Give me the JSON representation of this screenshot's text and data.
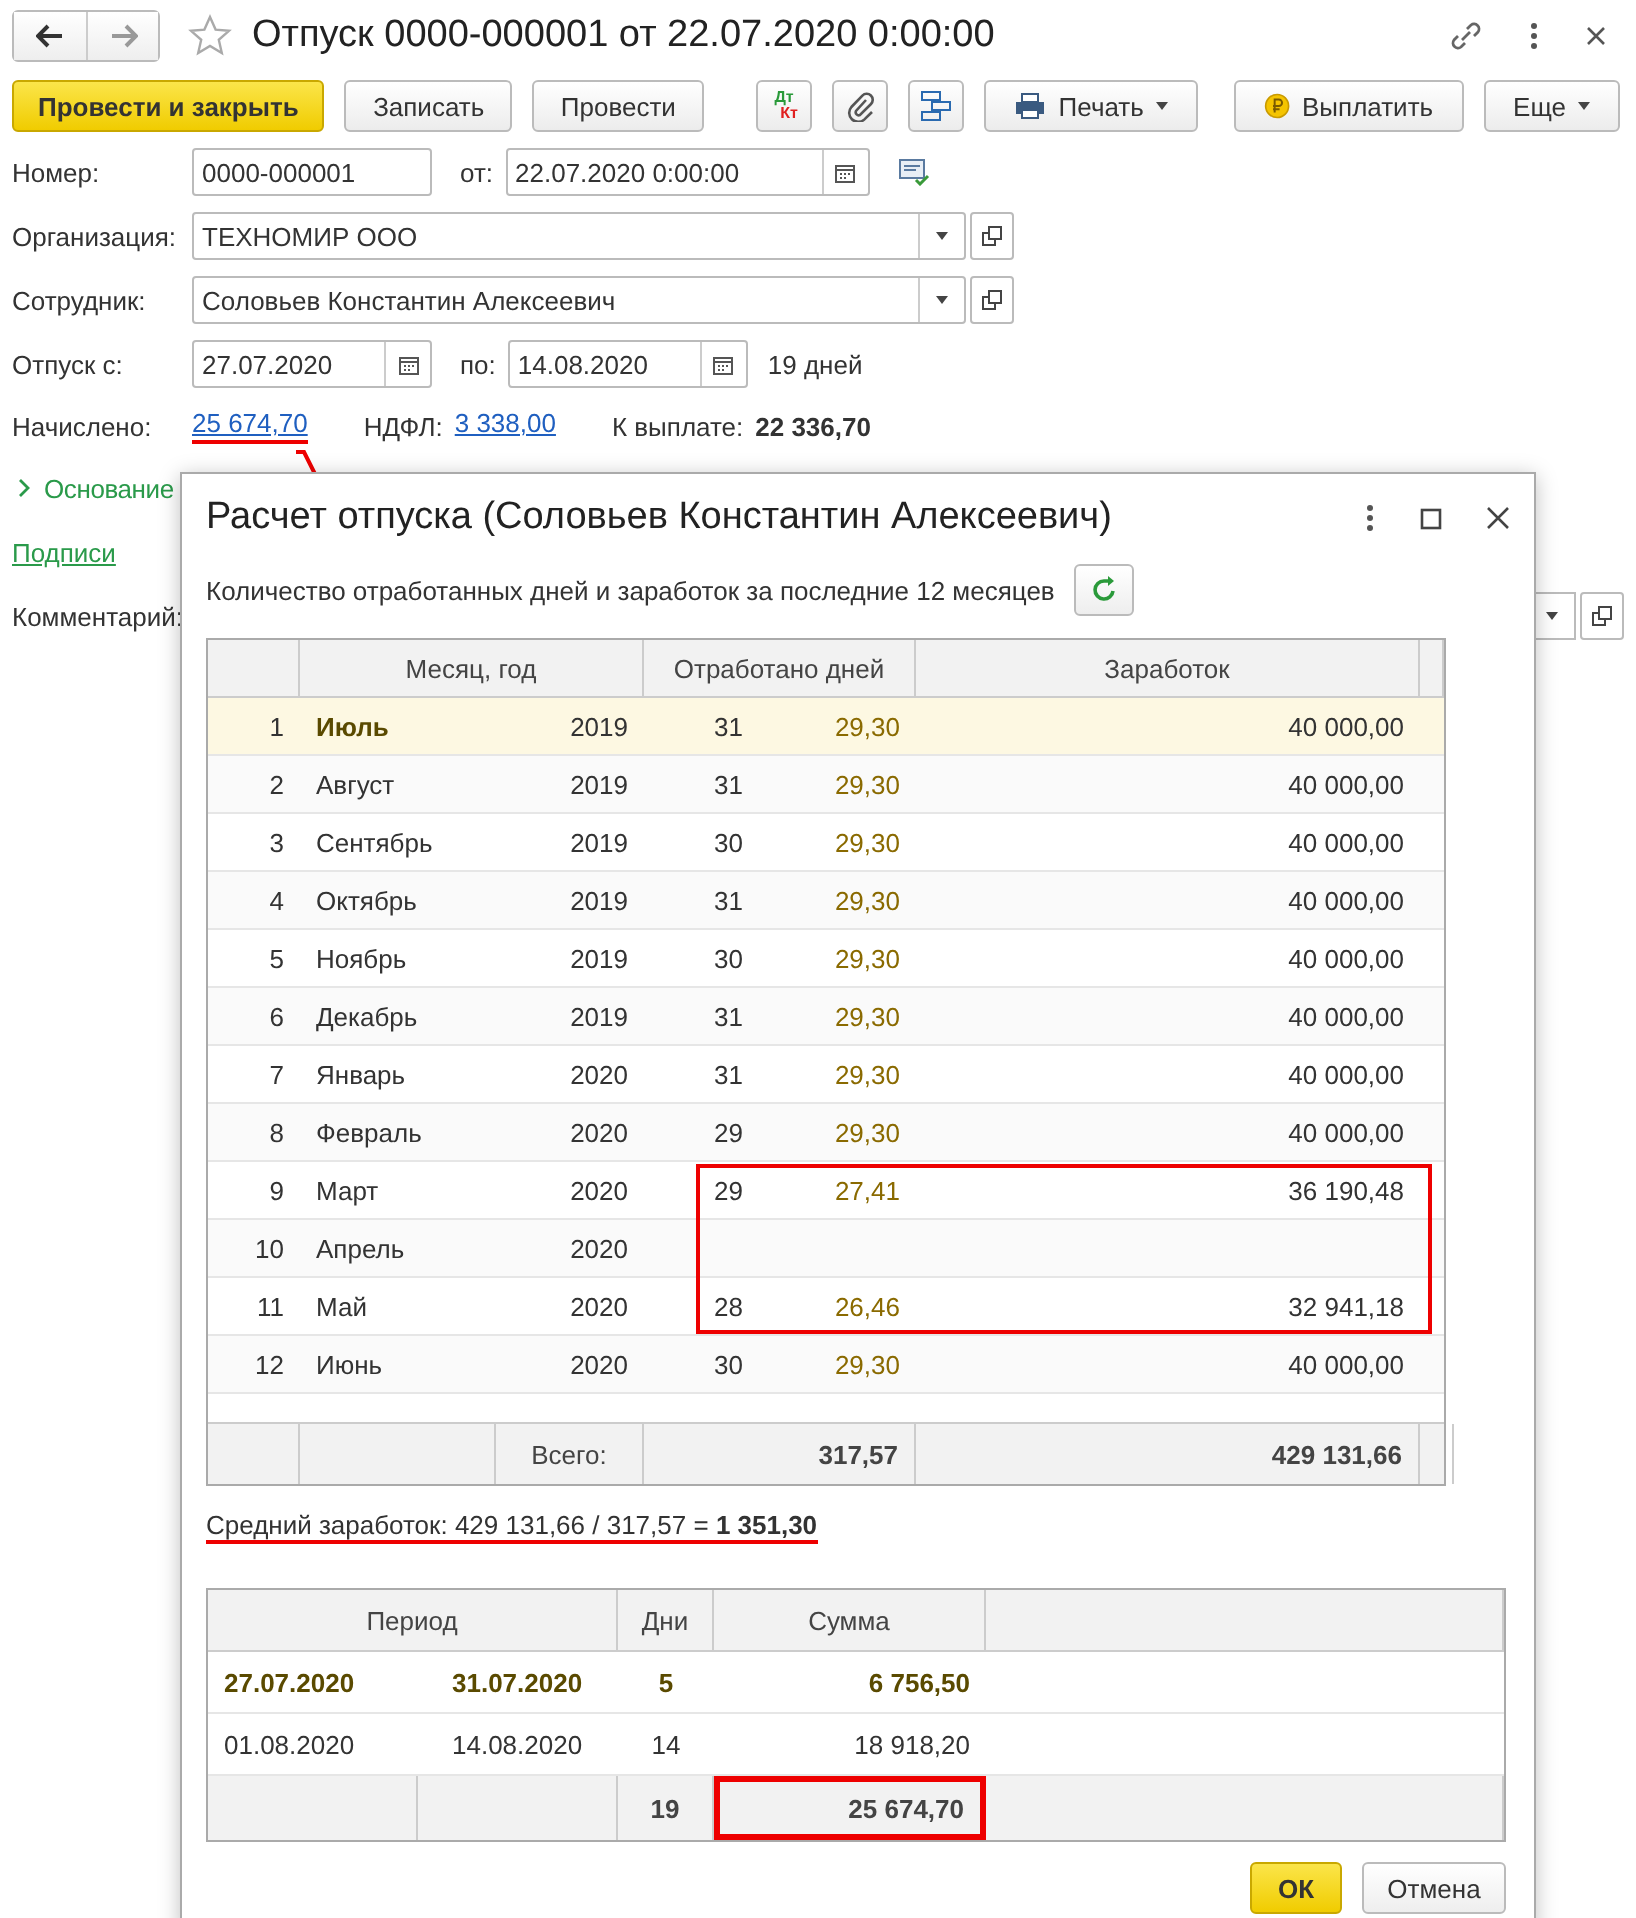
{
  "window": {
    "title": "Отпуск 0000-000001 от 22.07.2020 0:00:00"
  },
  "toolbar": [
    {
      "kind": "primary",
      "label": "Провести и закрыть"
    },
    {
      "kind": "text",
      "label": "Записать"
    },
    {
      "kind": "text",
      "label": "Провести"
    },
    {
      "kind": "dtkt",
      "label": "Дт",
      "label2": "Кт"
    },
    {
      "kind": "clip"
    },
    {
      "kind": "structure"
    },
    {
      "kind": "print",
      "label": "Печать"
    },
    {
      "kind": "pay",
      "label": "Выплатить"
    },
    {
      "kind": "more",
      "label": "Еще"
    }
  ],
  "number": {
    "label": "Номер:",
    "value": "0000-000001",
    "date_label": "от:",
    "date": "22.07.2020  0:00:00"
  },
  "organization": {
    "label": "Организация:",
    "value": "ТЕХНОМИР ООО"
  },
  "employee": {
    "label": "Сотрудник:",
    "value": "Соловьев Константин Алексеевич"
  },
  "vacation": {
    "label": "Отпуск с:",
    "from": "27.07.2020",
    "to_label": "по:",
    "to": "14.08.2020",
    "duration": "19 дней"
  },
  "totals": [
    {
      "kind": "link",
      "label": "Начислено:",
      "value": "25 674,70",
      "marked": true
    },
    {
      "kind": "link",
      "label": "НДФЛ:",
      "value": "3 338,00"
    },
    {
      "kind": "bold",
      "label": "К выплате:",
      "value": "22 336,70"
    }
  ],
  "basis": {
    "label": "Основание",
    "expanded": false
  },
  "signatures": "Подписи",
  "comment": {
    "label": "Комментарий:"
  },
  "dialog": {
    "title": "Расчет отпуска (Соловьев Константин Алексеевич)",
    "subtitle": "Количество отработанных дней и заработок за последние 12 месяцев",
    "earnings_columns": [
      "Месяц, год",
      "Отработано дней",
      "Заработок"
    ],
    "earnings_rows": [
      {
        "n": "1",
        "month": "Июль",
        "year": "2019",
        "days": "31",
        "coef": "29,30",
        "earnings": "40 000,00",
        "selected": true,
        "marked": false
      },
      {
        "n": "2",
        "month": "Август",
        "year": "2019",
        "days": "31",
        "coef": "29,30",
        "earnings": "40 000,00",
        "selected": false,
        "marked": false
      },
      {
        "n": "3",
        "month": "Сентябрь",
        "year": "2019",
        "days": "30",
        "coef": "29,30",
        "earnings": "40 000,00",
        "selected": false,
        "marked": false
      },
      {
        "n": "4",
        "month": "Октябрь",
        "year": "2019",
        "days": "31",
        "coef": "29,30",
        "earnings": "40 000,00",
        "selected": false,
        "marked": false
      },
      {
        "n": "5",
        "month": "Ноябрь",
        "year": "2019",
        "days": "30",
        "coef": "29,30",
        "earnings": "40 000,00",
        "selected": false,
        "marked": false
      },
      {
        "n": "6",
        "month": "Декабрь",
        "year": "2019",
        "days": "31",
        "coef": "29,30",
        "earnings": "40 000,00",
        "selected": false,
        "marked": false
      },
      {
        "n": "7",
        "month": "Январь",
        "year": "2020",
        "days": "31",
        "coef": "29,30",
        "earnings": "40 000,00",
        "selected": false,
        "marked": false
      },
      {
        "n": "8",
        "month": "Февраль",
        "year": "2020",
        "days": "29",
        "coef": "29,30",
        "earnings": "40 000,00",
        "selected": false,
        "marked": false
      },
      {
        "n": "9",
        "month": "Март",
        "year": "2020",
        "days": "29",
        "coef": "27,41",
        "earnings": "36 190,48",
        "selected": false,
        "marked": true
      },
      {
        "n": "10",
        "month": "Апрель",
        "year": "2020",
        "selected": false,
        "marked": true
      },
      {
        "n": "11",
        "month": "Май",
        "year": "2020",
        "days": "28",
        "coef": "26,46",
        "earnings": "32 941,18",
        "selected": false,
        "marked": true
      },
      {
        "n": "12",
        "month": "Июнь",
        "year": "2020",
        "days": "30",
        "coef": "29,30",
        "earnings": "40 000,00",
        "selected": false,
        "marked": false
      }
    ],
    "earnings_footer": {
      "label": "Всего:",
      "coef": "317,57",
      "earnings": "429 131,66"
    },
    "average": {
      "text": "Средний заработок: 429 131,66 / 317,57 = **1 351,30**",
      "underlined": true
    },
    "period_columns": [
      "Период",
      "Дни",
      "Сумма"
    ],
    "period_rows": [
      {
        "from": "27.07.2020",
        "to": "31.07.2020",
        "days": "5",
        "sum": "6 756,50",
        "selected": true
      },
      {
        "from": "01.08.2020",
        "to": "14.08.2020",
        "days": "14",
        "sum": "18 918,20",
        "selected": false
      }
    ],
    "period_footer": {
      "days": "19",
      "sum": "25 674,70",
      "marked": true
    },
    "buttons": [
      {
        "kind": "default",
        "label": "ОК"
      },
      {
        "kind": "plain",
        "label": "Отмена"
      }
    ]
  }
}
